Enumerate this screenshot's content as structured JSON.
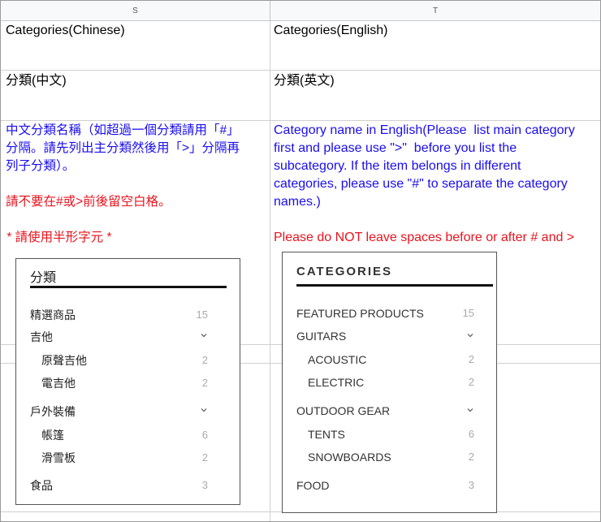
{
  "columns": {
    "s": "S",
    "t": "T"
  },
  "row1": {
    "s": "Categories(Chinese)",
    "t": "Categories(English)"
  },
  "row2": {
    "s": "分類(中文)",
    "t": "分類(英文)"
  },
  "row3": {
    "s_blue": "中文分類名稱（如超過一個分類請用「#」\n分隔。請先列出主分類然後用「>」分隔再\n列子分類）。",
    "s_red1": "請不要在#或>前後留空白格。",
    "s_red2": " * 請使用半形字元 *",
    "t_blue": "Category name in English(Please  list main category\nfirst and please use \">\"  before you list the\nsubcategory. If the item belongs in different\ncategories, please use \"#\" to separate the category\nnames.)",
    "t_red": "Please do NOT leave spaces before or after # and >"
  },
  "widget_zh": {
    "title": "分類",
    "items": [
      {
        "label": "精選商品",
        "count": "15"
      },
      {
        "label": "吉他"
      },
      {
        "label": "原聲吉他",
        "count": "2"
      },
      {
        "label": "電吉他",
        "count": "2"
      },
      {
        "label": "戶外裝備"
      },
      {
        "label": "帳篷",
        "count": "6"
      },
      {
        "label": "滑雪板",
        "count": "2"
      },
      {
        "label": "食品",
        "count": "3"
      }
    ]
  },
  "widget_en": {
    "title": "CATEGORIES",
    "items": [
      {
        "label": "FEATURED PRODUCTS",
        "count": "15"
      },
      {
        "label": "GUITARS"
      },
      {
        "label": "ACOUSTIC",
        "count": "2"
      },
      {
        "label": "ELECTRIC",
        "count": "2"
      },
      {
        "label": "OUTDOOR GEAR"
      },
      {
        "label": "TENTS",
        "count": "6"
      },
      {
        "label": "SNOWBOARDS",
        "count": "2"
      },
      {
        "label": "FOOD",
        "count": "3"
      }
    ]
  },
  "icons": {
    "chevron": "chevron-down-icon"
  }
}
